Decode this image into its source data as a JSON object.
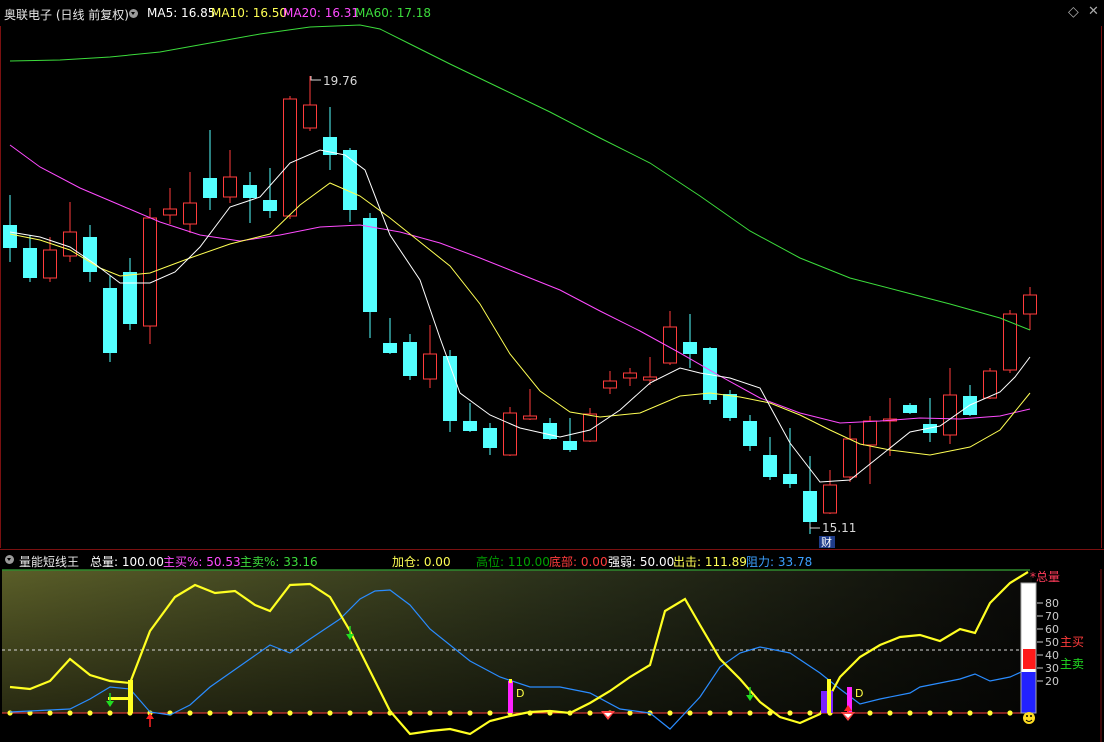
{
  "stock": {
    "title": "奥联电子 (日线 前复权)",
    "ma5": "MA5: 16.85",
    "ma10": "MA10: 16.50",
    "ma20": "MA20: 16.31",
    "ma60": "MA60: 17.18",
    "high_marker": "19.76",
    "low_marker": "15.11",
    "finance_badge": "财"
  },
  "indicator": {
    "name": "量能短线王",
    "total": "总量: 100.00",
    "main_buy_pct": "主买%: 50.53",
    "main_sell_pct": "主卖%: 33.16",
    "add_position": "加仓: 0.00",
    "high_pos": "高位: 110.00",
    "bottom": "底部: 0.00",
    "strength": "强弱: 50.00",
    "strike": "出击: 111.89",
    "resistance": "阻力: 33.78",
    "gauge_total_label": "*总量",
    "gauge_buy_label": "主买",
    "gauge_sell_label": "主卖",
    "gauge_ticks": [
      "80",
      "70",
      "60",
      "50",
      "40",
      "30",
      "20"
    ],
    "d_marker": "D"
  },
  "colors": {
    "up": "#ff3c3c",
    "down": "#54ffff",
    "ma5": "#ffffff",
    "ma10": "#ffff54",
    "ma20": "#ff4bff",
    "ma60": "#3cdc3c"
  }
}
